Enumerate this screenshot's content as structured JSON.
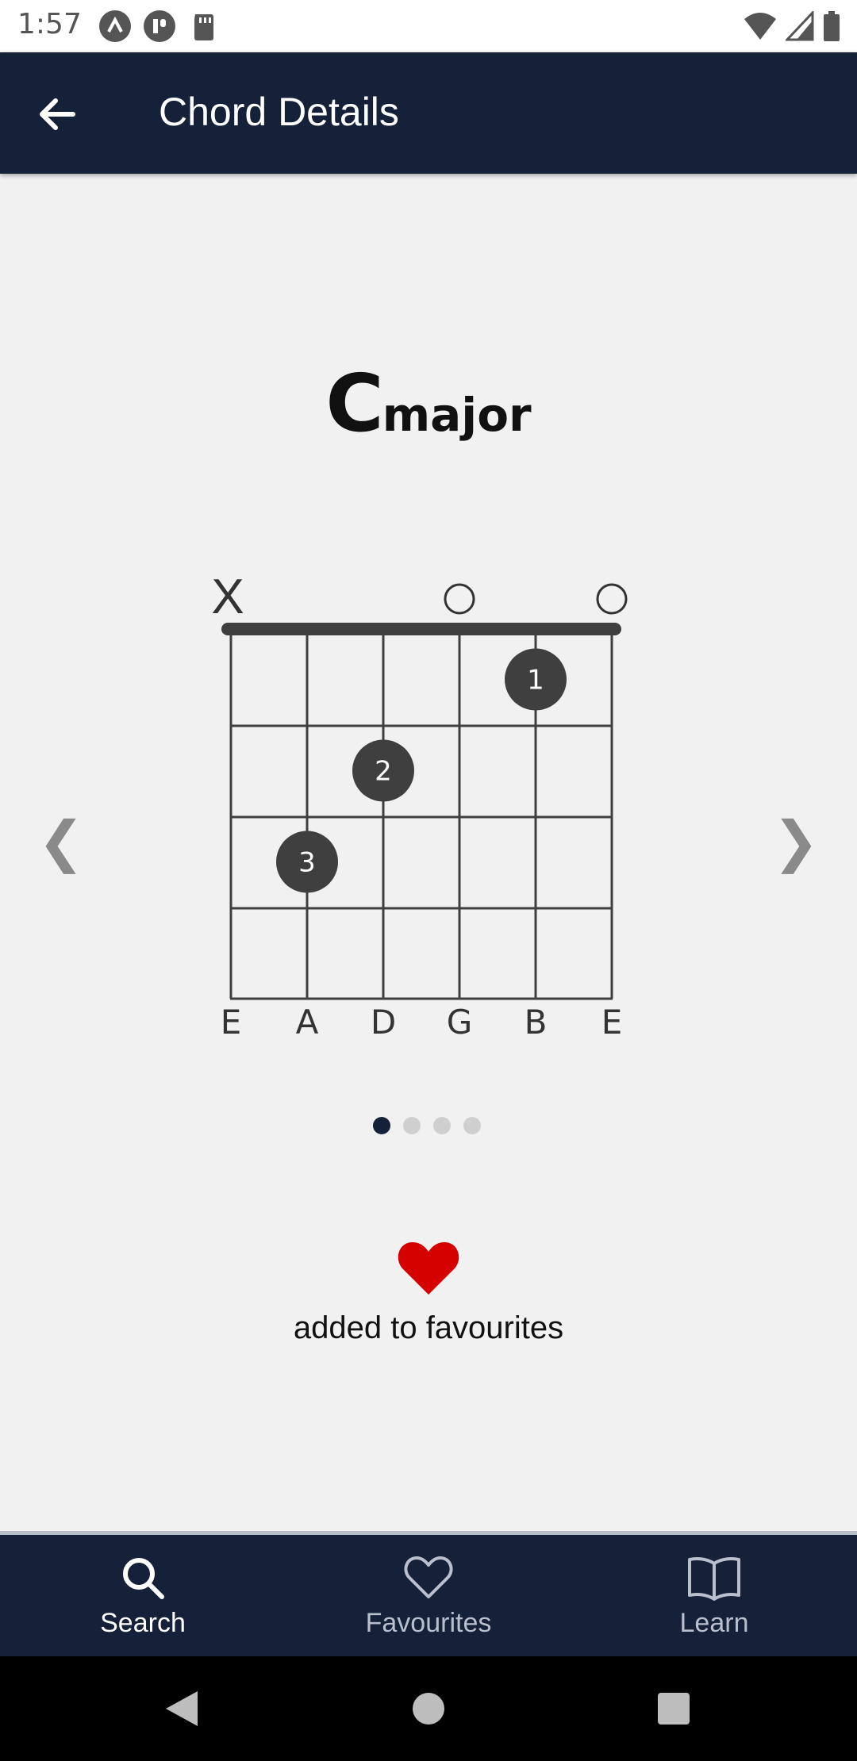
{
  "status": {
    "time": "1:57"
  },
  "appbar": {
    "title": "Chord Details"
  },
  "chord": {
    "root": "C",
    "quality": "major"
  },
  "diagram": {
    "string_names": [
      "E",
      "A",
      "D",
      "G",
      "B",
      "E"
    ],
    "string_markers": [
      "X",
      "",
      "",
      "O",
      "",
      "O"
    ],
    "frets_shown": 4,
    "fingers": [
      {
        "label": "1",
        "string": 5,
        "fret": 1
      },
      {
        "label": "2",
        "string": 3,
        "fret": 2
      },
      {
        "label": "3",
        "string": 2,
        "fret": 3
      }
    ]
  },
  "pager": {
    "count": 4,
    "active": 0
  },
  "favourite": {
    "text": "added to favourites",
    "color": "#d50000"
  },
  "bottom_nav": {
    "tabs": [
      {
        "label": "Search",
        "icon": "search-icon",
        "active": true
      },
      {
        "label": "Favourites",
        "icon": "heart-outline-icon",
        "active": false
      },
      {
        "label": "Learn",
        "icon": "book-icon",
        "active": false
      }
    ]
  },
  "colors": {
    "primary": "#152039",
    "background": "#f1f1f1",
    "finger": "#3f3f3f"
  }
}
